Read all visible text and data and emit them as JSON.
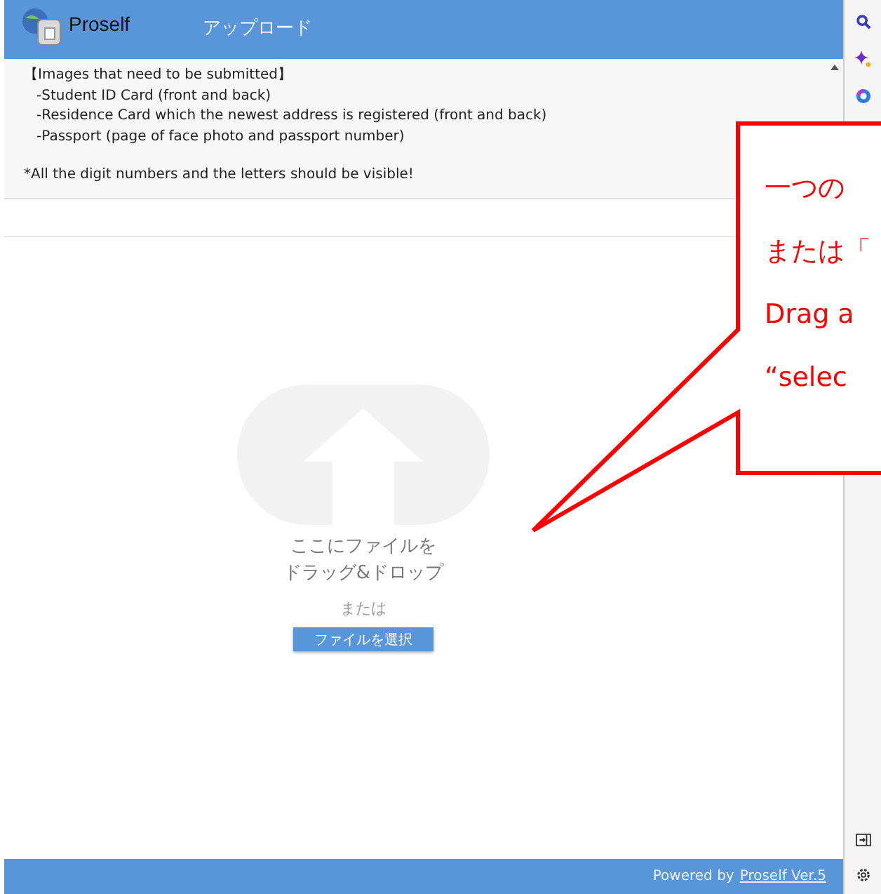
{
  "header": {
    "app_name": "Proself",
    "title": "アップロード"
  },
  "notice": {
    "heading": "【Images that need to be submitted】",
    "items": [
      "-Student ID Card (front and back)",
      "-Residence Card which the newest address is registered (front and back)",
      "-Passport (page of face photo and passport number)"
    ],
    "note": "*All the digit numbers and the letters should be visible!"
  },
  "dropzone": {
    "hint_lines": [
      "ここにファイルを",
      "ドラッグ&ドロップ"
    ],
    "or": "または",
    "button": "ファイルを選択"
  },
  "callout": {
    "lines": [
      "一つの",
      "または「",
      "Drag a",
      "“selec"
    ]
  },
  "footer": {
    "prefix": "Powered by",
    "link": "Proself Ver.5"
  }
}
